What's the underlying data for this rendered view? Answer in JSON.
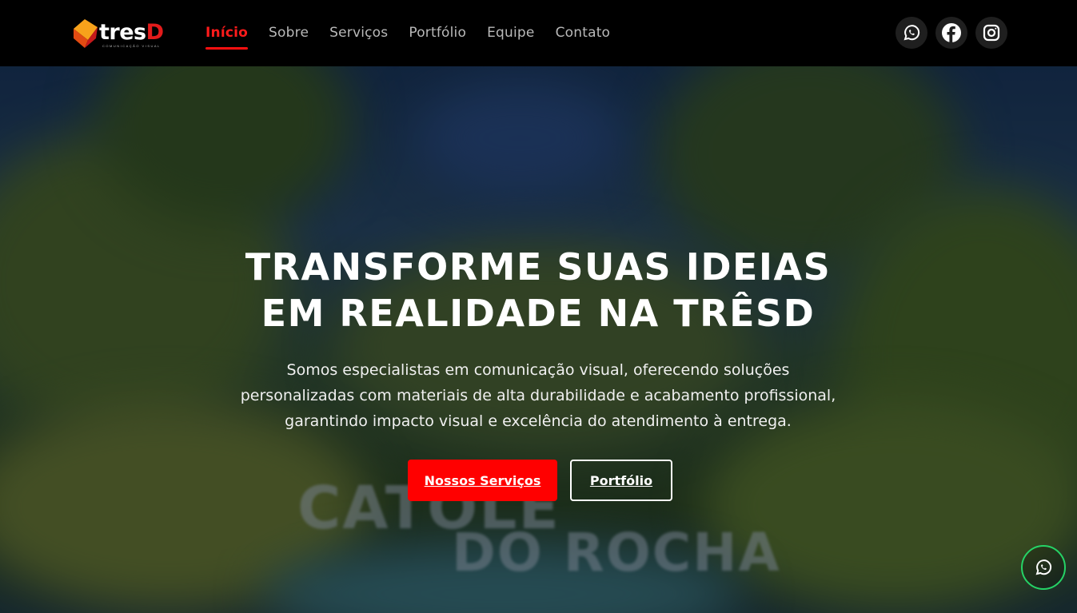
{
  "brand": {
    "name_main": "tres",
    "name_accent": "D",
    "tagline": "COMUNICAÇÃO VISUAL",
    "mark_color": "#f7a21b",
    "accent_color": "#e31b1b"
  },
  "nav": {
    "items": [
      {
        "label": "Início",
        "active": true
      },
      {
        "label": "Sobre",
        "active": false
      },
      {
        "label": "Serviços",
        "active": false
      },
      {
        "label": "Portfólio",
        "active": false
      },
      {
        "label": "Equipe",
        "active": false
      },
      {
        "label": "Contato",
        "active": false
      }
    ]
  },
  "socials": [
    {
      "icon": "whatsapp-icon"
    },
    {
      "icon": "facebook-icon"
    },
    {
      "icon": "instagram-icon"
    }
  ],
  "hero": {
    "title_line1": "TRANSFORME SUAS IDEIAS",
    "title_line2": "EM REALIDADE NA TRÊSD",
    "lead_line1": "Somos especialistas em comunicação visual, oferecendo soluções",
    "lead_line2": "personalizadas com materiais de alta durabilidade e acabamento profissional,",
    "lead_line3": "garantindo impacto visual e excelência do atendimento à entrega.",
    "primary_button": "Nossos Serviços",
    "secondary_button": "Portfólio",
    "background_sign_line1": "CATOLÉ",
    "background_sign_line2": "DO ROCHA"
  },
  "floating": {
    "icon": "whatsapp-icon",
    "color": "#25d366"
  }
}
